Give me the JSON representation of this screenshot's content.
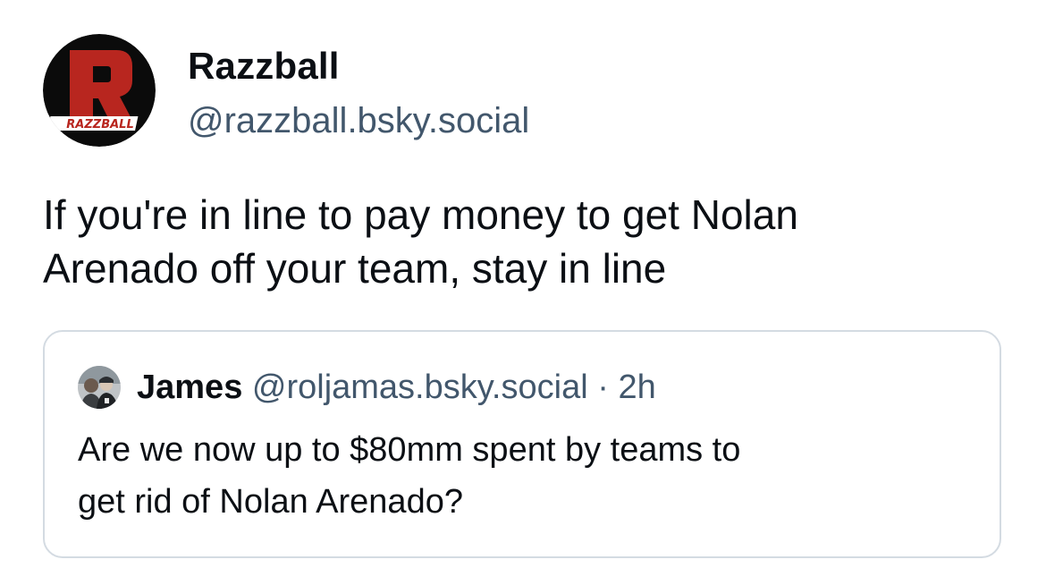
{
  "post": {
    "author": {
      "display_name": "Razzball",
      "handle": "@razzball.bsky.social",
      "avatar": {
        "icon": "razzball-logo-icon",
        "letter": "R",
        "wordmark": "RAZZBALL",
        "colors": {
          "background": "#0b0b0b",
          "letter": "#b8261f",
          "ring": "#ffffff"
        }
      }
    },
    "text_lines": [
      "If you're in line to pay money to get Nolan",
      "Arenado off your team, stay in line"
    ]
  },
  "quote": {
    "author": {
      "display_name": "James",
      "handle": "@roljamas.bsky.social",
      "separator": "·",
      "time": "2h",
      "avatar": {
        "icon": "user-photo-avatar-icon"
      }
    },
    "text_lines": [
      "Are we now up to $80mm spent by teams to",
      "get rid of Nolan Arenado?"
    ]
  },
  "colors": {
    "primary_text": "#0b0f14",
    "secondary_text": "#42576c",
    "card_border": "#d4dbe2"
  }
}
